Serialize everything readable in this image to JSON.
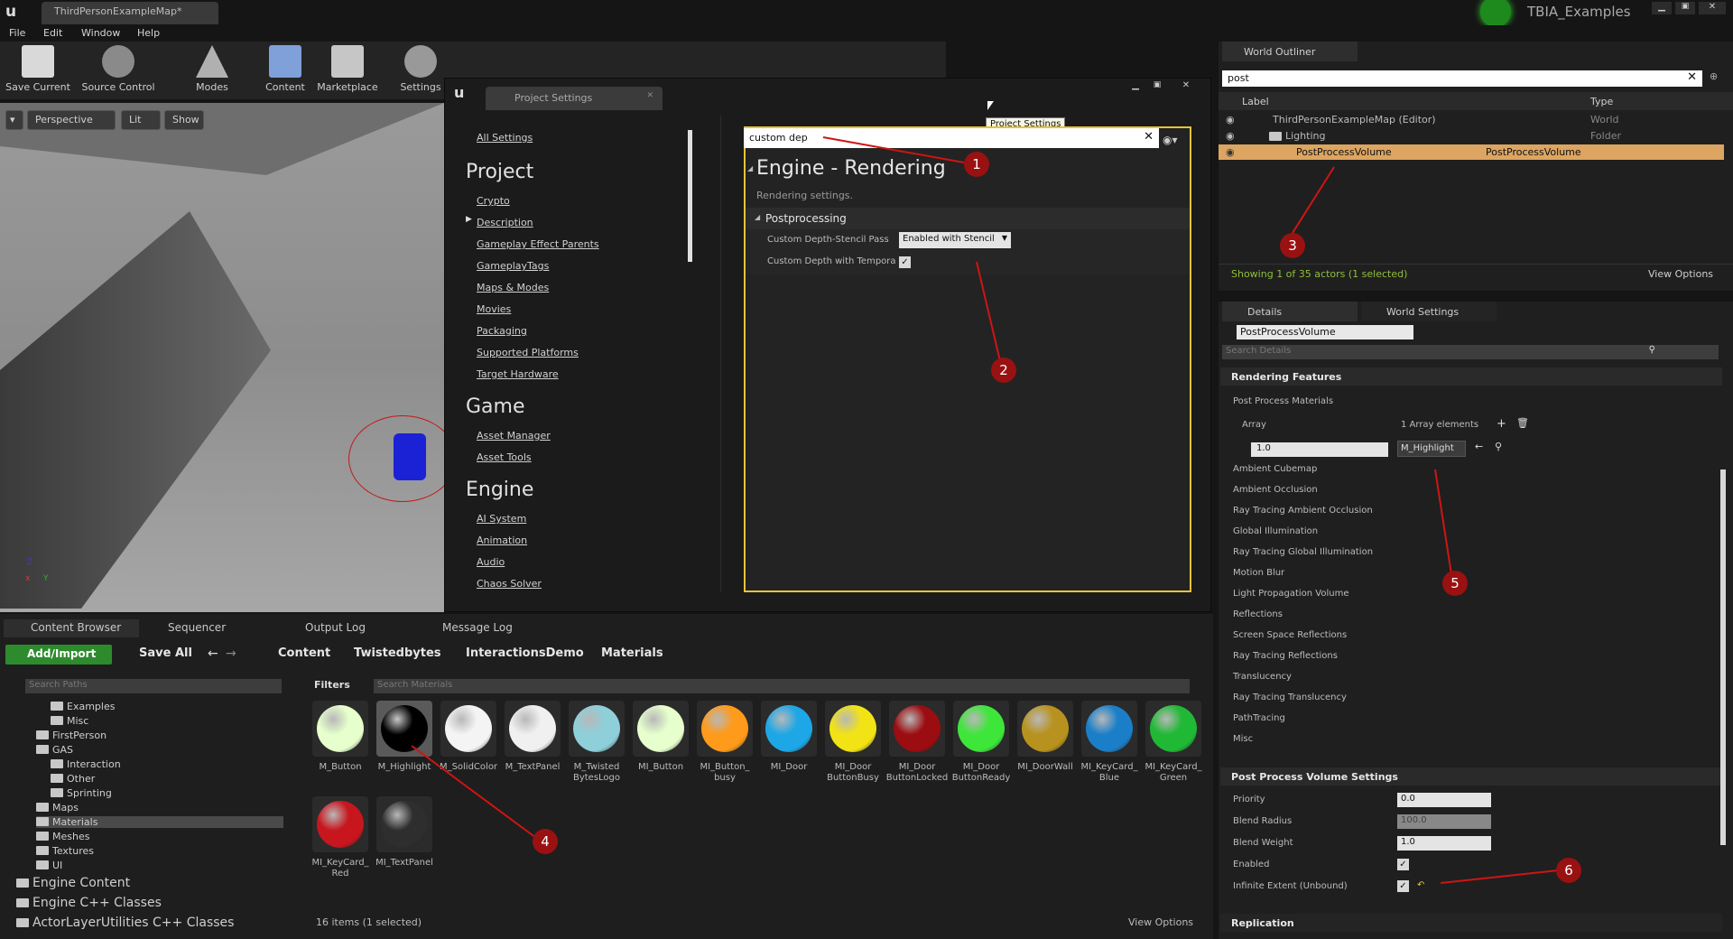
{
  "window": {
    "map_tab": "ThirdPersonExampleMap*",
    "project_badge": "TBIA_Examples"
  },
  "menu": [
    "File",
    "Edit",
    "Window",
    "Help"
  ],
  "toolbar": [
    "Save Current",
    "Source Control",
    "Modes",
    "Content",
    "Marketplace",
    "Settings"
  ],
  "viewport": {
    "perspective": "Perspective",
    "lit": "Lit",
    "show": "Show",
    "axis_x": "x",
    "axis_y": "Y",
    "axis_z": "Z"
  },
  "project_settings": {
    "tab": "Project Settings",
    "tooltip": "Project Settings",
    "nav": {
      "all": "All Settings",
      "project_head": "Project",
      "project_items": [
        "Crypto",
        "Description",
        "Gameplay Effect Parents",
        "GameplayTags",
        "Maps & Modes",
        "Movies",
        "Packaging",
        "Supported Platforms",
        "Target Hardware"
      ],
      "game_head": "Game",
      "game_items": [
        "Asset Manager",
        "Asset Tools"
      ],
      "engine_head": "Engine",
      "engine_items": [
        "AI System",
        "Animation",
        "Audio",
        "Chaos Solver"
      ]
    },
    "search_value": "custom dep",
    "section_title": "Engine - Rendering",
    "section_sub": "Rendering settings.",
    "category": "Postprocessing",
    "prop1_label": "Custom Depth-Stencil Pass",
    "prop1_value": "Enabled with Stencil",
    "prop2_label": "Custom Depth with Tempora"
  },
  "outliner": {
    "tab": "World Outliner",
    "search_value": "post",
    "col_label": "Label",
    "col_type": "Type",
    "rows": [
      {
        "label": "ThirdPersonExampleMap (Editor)",
        "type": "World"
      },
      {
        "label": "Lighting",
        "type": "Folder"
      },
      {
        "label": "PostProcessVolume",
        "type": "PostProcessVolume"
      }
    ],
    "status": "Showing 1 of 35 actors (1 selected)",
    "view_options": "View Options"
  },
  "details": {
    "tab_details": "Details",
    "tab_world": "World Settings",
    "actor_name": "PostProcessVolume",
    "search_placeholder": "Search Details",
    "rendering_features": "Rendering Features",
    "ppm": "Post Process Materials",
    "array": "Array",
    "array_value": "1 Array elements",
    "element_weight": "1.0",
    "element_material": "M_Highlight",
    "categories": [
      "Ambient Cubemap",
      "Ambient Occlusion",
      "Ray Tracing Ambient Occlusion",
      "Global Illumination",
      "Ray Tracing Global Illumination",
      "Motion Blur",
      "Light Propagation Volume",
      "Reflections",
      "Screen Space Reflections",
      "Ray Tracing Reflections",
      "Translucency",
      "Ray Tracing Translucency",
      "PathTracing",
      "Misc"
    ],
    "ppv_settings": "Post Process Volume Settings",
    "priority_label": "Priority",
    "priority_value": "0.0",
    "blend_radius_label": "Blend Radius",
    "blend_radius_value": "100.0",
    "blend_weight_label": "Blend Weight",
    "blend_weight_value": "1.0",
    "enabled_label": "Enabled",
    "infinite_label": "Infinite Extent (Unbound)",
    "replication": "Replication"
  },
  "content_browser": {
    "tabs": [
      "Content Browser",
      "Sequencer",
      "Output Log",
      "Message Log"
    ],
    "add_import": "Add/Import",
    "save_all": "Save All",
    "breadcrumb": [
      "Content",
      "Twistedbytes",
      "InteractionsDemo",
      "Materials"
    ],
    "search_paths": "Search Paths",
    "filters": "Filters",
    "search_materials": "Search Materials",
    "tree": [
      {
        "label": "Examples",
        "indent": 2
      },
      {
        "label": "Misc",
        "indent": 2
      },
      {
        "label": "FirstPerson",
        "indent": 1
      },
      {
        "label": "GAS",
        "indent": 1
      },
      {
        "label": "Interaction",
        "indent": 2
      },
      {
        "label": "Other",
        "indent": 2
      },
      {
        "label": "Sprinting",
        "indent": 2
      },
      {
        "label": "Maps",
        "indent": 1
      },
      {
        "label": "Materials",
        "indent": 1
      },
      {
        "label": "Meshes",
        "indent": 1
      },
      {
        "label": "Textures",
        "indent": 1
      },
      {
        "label": "UI",
        "indent": 1
      }
    ],
    "roots": [
      "Engine Content",
      "Engine C++ Classes",
      "ActorLayerUtilities C++ Classes"
    ],
    "assets": [
      {
        "label": "M_Button",
        "color": "#e6ffcc"
      },
      {
        "label": "M_Highlight",
        "color": "#000000"
      },
      {
        "label": "M_SolidColor",
        "color": "#f4f4f4"
      },
      {
        "label": "M_TextPanel",
        "color": "#f0f0f0"
      },
      {
        "label": "M_Twisted BytesLogo",
        "color": "#8ecfd9"
      },
      {
        "label": "MI_Button",
        "color": "#e6ffcc"
      },
      {
        "label": "MI_Button_ busy",
        "color": "#ff9a1a"
      },
      {
        "label": "MI_Door",
        "color": "#1ea7e6"
      },
      {
        "label": "MI_Door ButtonBusy",
        "color": "#f2e414"
      },
      {
        "label": "MI_Door ButtonLocked",
        "color": "#9b0d10"
      },
      {
        "label": "MI_Door ButtonReady",
        "color": "#3ee63a"
      },
      {
        "label": "MI_DoorWall",
        "color": "#b8921e"
      },
      {
        "label": "MI_KeyCard_ Blue",
        "color": "#1a7fc8"
      },
      {
        "label": "MI_KeyCard_ Green",
        "color": "#20b935"
      },
      {
        "label": "MI_KeyCard_ Red",
        "color": "#c8161e"
      },
      {
        "label": "MI_TextPanel",
        "color": "#2e2e2e"
      }
    ],
    "status": "16 items (1 selected)",
    "view_options": "View Options"
  },
  "annotations": [
    "1",
    "2",
    "3",
    "4",
    "5",
    "6"
  ]
}
